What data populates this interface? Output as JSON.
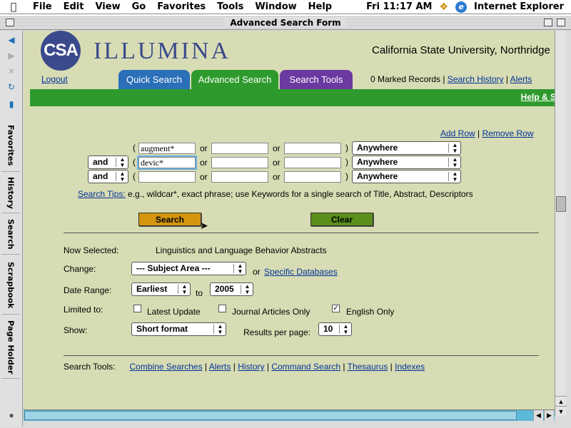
{
  "menubar": {
    "items": [
      "File",
      "Edit",
      "View",
      "Go",
      "Favorites",
      "Tools",
      "Window",
      "Help"
    ],
    "clock": "Fri 11:17 AM",
    "app_name": "Internet Explorer"
  },
  "window": {
    "title": "Advanced Search Form"
  },
  "sidebar": {
    "tabs": [
      "Favorites",
      "History",
      "Search",
      "Scrapbook",
      "Page Holder"
    ]
  },
  "header": {
    "logo_initials": "CSA",
    "logo_name": "ILLUMINA",
    "university": "California State University, Northridge",
    "logout": "Logout",
    "tabs": [
      "Quick Search",
      "Advanced Search",
      "Search Tools"
    ],
    "marked_records": "0 Marked Records",
    "search_history": "Search History",
    "alerts": "Alerts",
    "help": "Help & Support"
  },
  "search": {
    "add_row": "Add Row",
    "remove_row": "Remove Row",
    "or_label": "or",
    "rows": [
      {
        "operator": "",
        "term1": "augment*",
        "term2": "",
        "term3": "",
        "field": "Anywhere"
      },
      {
        "operator": "and",
        "term1": "devic*",
        "term2": "",
        "term3": "",
        "field": "Anywhere"
      },
      {
        "operator": "and",
        "term1": "",
        "term2": "",
        "term3": "",
        "field": "Anywhere"
      }
    ],
    "tips_link": "Search Tips:",
    "tips_text": "e.g., wildcar*, exact phrase; use Keywords for a single search of Title, Abstract, Descriptors",
    "search_button": "Search",
    "clear_button": "Clear"
  },
  "options": {
    "now_selected_label": "Now Selected:",
    "now_selected_value": "Linguistics and Language Behavior Abstracts",
    "change_label": "Change:",
    "subject_area": "--- Subject Area ---",
    "or_text": "or",
    "specific_databases": "Specific Databases",
    "date_range_label": "Date Range:",
    "date_from": "Earliest",
    "to_text": "to",
    "date_to": "2005",
    "limited_label": "Limited to:",
    "limits": [
      {
        "label": "Latest Update",
        "checked": false
      },
      {
        "label": "Journal Articles Only",
        "checked": false
      },
      {
        "label": "English Only",
        "checked": true
      }
    ],
    "show_label": "Show:",
    "show_format": "Short format",
    "results_label": "Results per page:",
    "results_value": "10"
  },
  "footer": {
    "label": "Search Tools:",
    "links": [
      "Combine Searches",
      "Alerts",
      "History",
      "Command Search",
      "Thesaurus",
      "Indexes"
    ]
  }
}
